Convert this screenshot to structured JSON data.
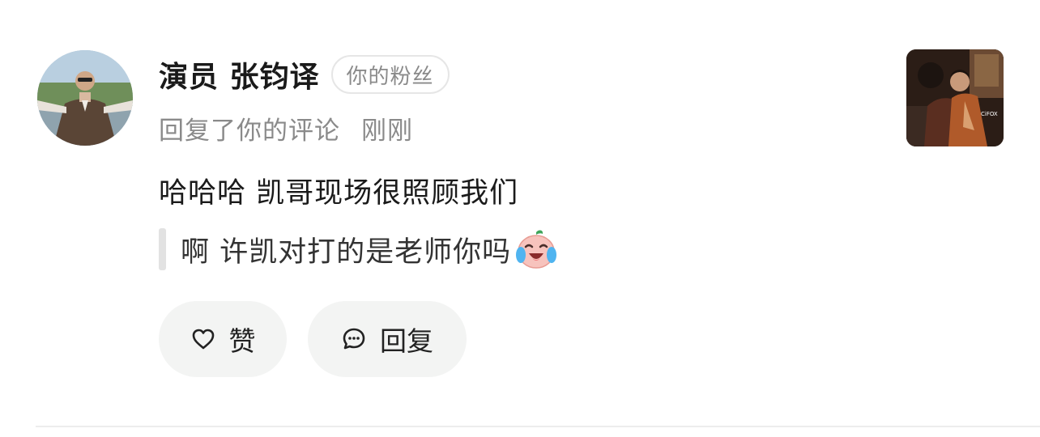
{
  "comment": {
    "username": "演员 张钧译",
    "badge": "你的粉丝",
    "action_text": "回复了你的评论",
    "time": "刚刚",
    "reply_text": "哈哈哈 凯哥现场很照顾我们",
    "quoted_text": "啊 许凯对打的是老师你吗",
    "quoted_emoji": "laugh-cry-emoji"
  },
  "actions": {
    "like_label": "赞",
    "like_icon": "heart-outline-icon",
    "reply_label": "回复",
    "reply_icon": "chat-bubble-icon"
  },
  "thumbnail": {
    "watermark": "CiFOX"
  },
  "colors": {
    "secondary_text": "#8a8a8a",
    "button_bg": "#f3f4f3",
    "quote_bar": "#e2e2e2"
  }
}
